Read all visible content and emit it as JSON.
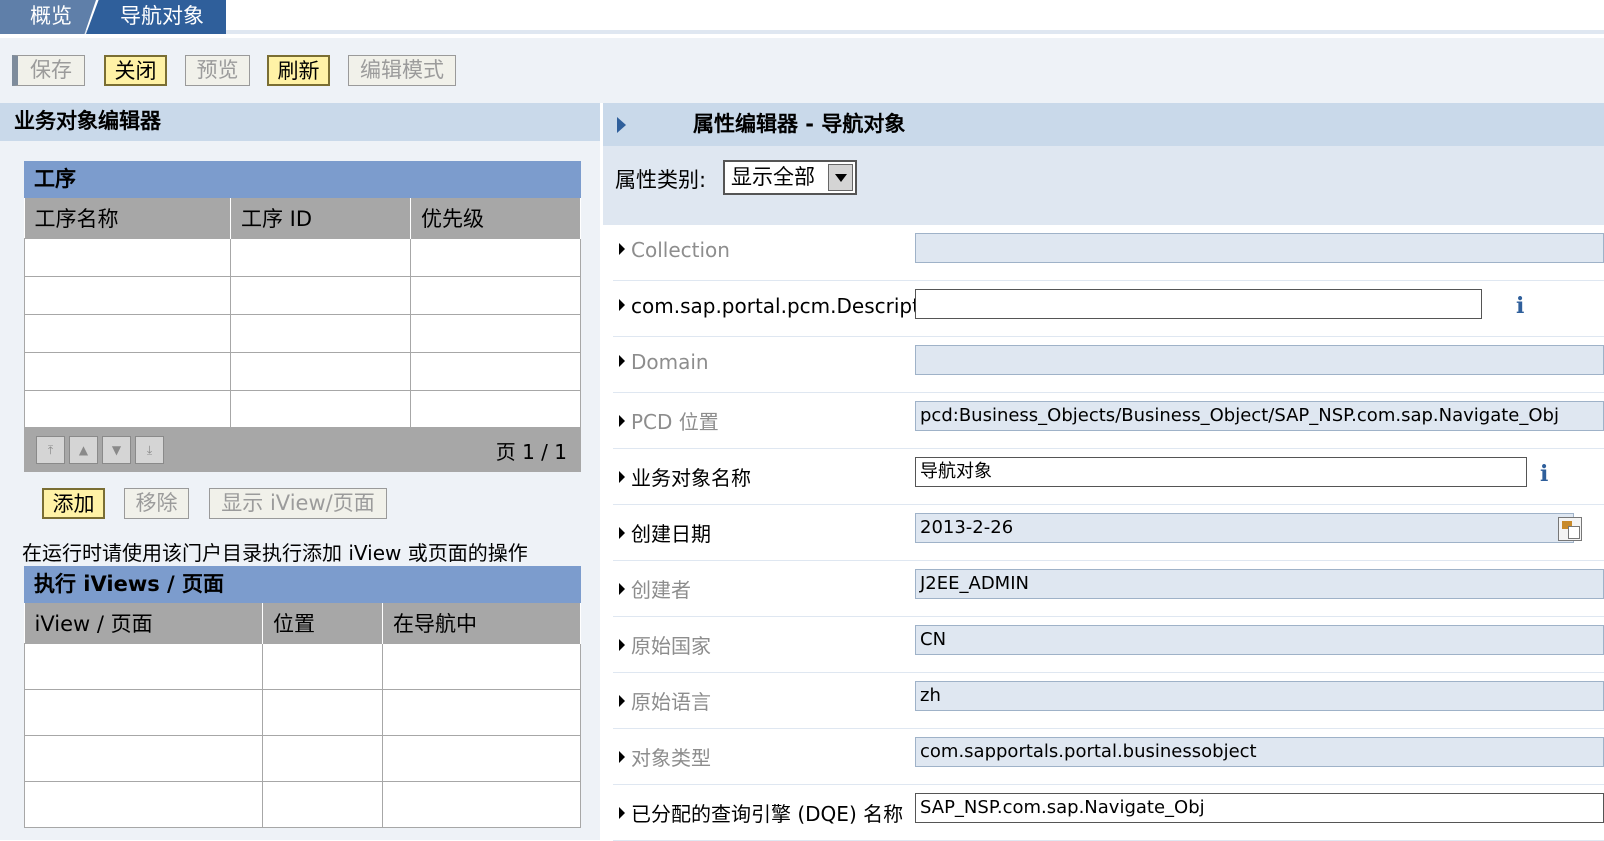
{
  "tabs": [
    {
      "label": "概览"
    },
    {
      "label": "导航对象"
    }
  ],
  "toolbar": {
    "save": "保存",
    "close": "关闭",
    "preview": "预览",
    "refresh": "刷新",
    "edit_mode": "编辑模式"
  },
  "left_panel": {
    "title": "业务对象编辑器",
    "steps": {
      "title": "工序",
      "columns": [
        "工序名称",
        "工序 ID",
        "优先级"
      ],
      "pager": "页 1 / 1"
    },
    "actions": {
      "add": "添加",
      "remove": "移除",
      "show": "显示 iView/页面"
    },
    "note": "在运行时请使用该门户目录执行添加 iView 或页面的操作",
    "iviews": {
      "title": "执行 iViews / 页面",
      "columns": [
        "iView / 页面",
        "位置",
        "在导航中"
      ]
    }
  },
  "right_panel": {
    "title": "属性编辑器 - 导航对象",
    "filter_label": "属性类别:",
    "filter_value": "显示全部",
    "properties": [
      {
        "label": "Collection",
        "value": ""
      },
      {
        "label": "com.sap.portal.pcm.Description",
        "value": ""
      },
      {
        "label": "Domain",
        "value": ""
      },
      {
        "label": "PCD 位置",
        "value": "pcd:Business_Objects/Business_Object/SAP_NSP.com.sap.Navigate_Obj"
      },
      {
        "label": "业务对象名称",
        "value": "导航对象"
      },
      {
        "label": "创建日期",
        "value": "2013-2-26"
      },
      {
        "label": "创建者",
        "value": "J2EE_ADMIN"
      },
      {
        "label": "原始国家",
        "value": "CN"
      },
      {
        "label": "原始语言",
        "value": "zh"
      },
      {
        "label": "对象类型",
        "value": "com.sapportals.portal.businessobject"
      },
      {
        "label": "已分配的查询引擎 (DQE) 名称",
        "value": "SAP_NSP.com.sap.Navigate_Obj"
      }
    ]
  }
}
